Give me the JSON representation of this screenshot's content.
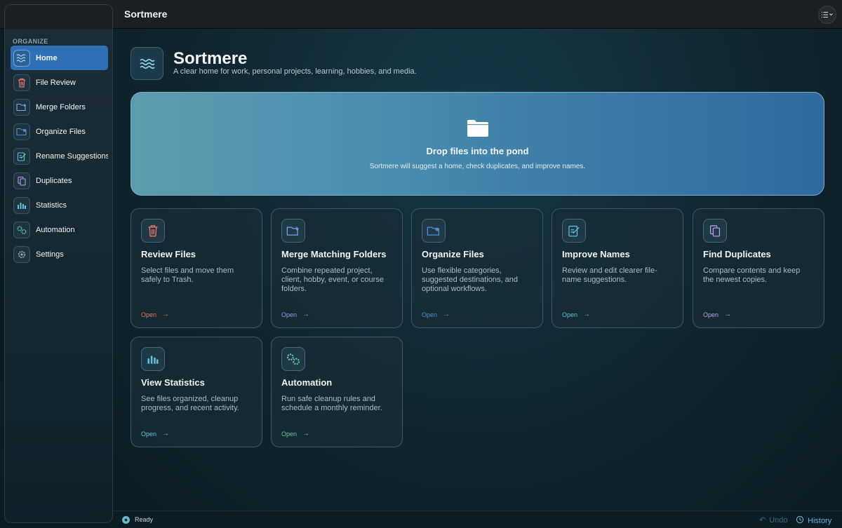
{
  "app": {
    "title": "Sortmere"
  },
  "sidebar": {
    "section": "ORGANIZE",
    "items": [
      {
        "label": "Home",
        "icon": "waves-icon"
      },
      {
        "label": "File Review",
        "icon": "trash-icon"
      },
      {
        "label": "Merge Folders",
        "icon": "folder-plus-icon"
      },
      {
        "label": "Organize Files",
        "icon": "folder-icon"
      },
      {
        "label": "Rename Suggestions",
        "icon": "pencil-note-icon"
      },
      {
        "label": "Duplicates",
        "icon": "copy-icon"
      },
      {
        "label": "Statistics",
        "icon": "bar-chart-icon"
      },
      {
        "label": "Automation",
        "icon": "gears-icon"
      },
      {
        "label": "Settings",
        "icon": "gear-icon"
      }
    ]
  },
  "hero": {
    "title": "Sortmere",
    "subtitle": "A clear home for work, personal projects, learning, hobbies, and media."
  },
  "dropzone": {
    "title": "Drop files into the pond",
    "subtitle": "Sortmere will suggest a home, check duplicates, and improve names."
  },
  "cards": [
    {
      "title": "Review Files",
      "desc": "Select files and move them safely to Trash.",
      "open": "Open",
      "accent": "#e8756a"
    },
    {
      "title": "Merge Matching Folders",
      "desc": "Combine repeated project, client, hobby, event, or course folders.",
      "open": "Open",
      "accent": "#7ea2e8"
    },
    {
      "title": "Organize Files",
      "desc": "Use flexible categories, suggested destinations, and optional workflows.",
      "open": "Open",
      "accent": "#4b8fd0"
    },
    {
      "title": "Improve Names",
      "desc": "Review and edit clearer file-name suggestions.",
      "open": "Open",
      "accent": "#5ac2d6"
    },
    {
      "title": "Find Duplicates",
      "desc": "Compare contents and keep the newest copies.",
      "open": "Open",
      "accent": "#b69be6"
    },
    {
      "title": "View Statistics",
      "desc": "See files organized, cleanup progress, and recent activity.",
      "open": "Open",
      "accent": "#63c1d9"
    },
    {
      "title": "Automation",
      "desc": "Run safe cleanup rules and schedule a monthly reminder.",
      "open": "Open",
      "accent": "#67c6a0"
    }
  ],
  "status": {
    "text": "Ready",
    "undo": "Undo",
    "history": "History"
  }
}
